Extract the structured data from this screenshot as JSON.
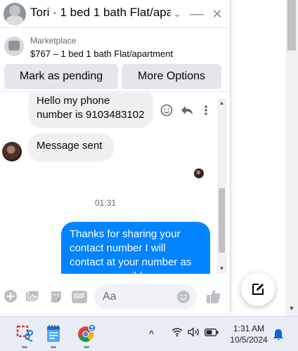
{
  "header": {
    "title": "Tori · 1 bed 1 bath Flat/apa...",
    "minimize_glyph": "—",
    "close_glyph": "✕",
    "dropdown_glyph": "⌄"
  },
  "marketplace": {
    "label": "Marketplace",
    "listing": "$767 – 1 bed 1 bath Flat/apartment",
    "buttons": [
      "Mark as pending",
      "More Options"
    ]
  },
  "messages": [
    {
      "direction": "incoming",
      "text": "Hello my phone number is 9103483102"
    },
    {
      "direction": "incoming",
      "text": "Message sent"
    },
    {
      "direction": "outgoing",
      "text": "Thanks for sharing your contact number I will contact at your number as soon as possible"
    }
  ],
  "timestamp": "01:31",
  "composer": {
    "placeholder": "Aa",
    "gif_label": "GIF"
  },
  "taskbar": {
    "time": "1:31 AM",
    "date": "10/5/2024",
    "tray_chevron": "^"
  },
  "colors": {
    "outgoing_bubble": "#0084ff",
    "incoming_bubble": "#f0f0f0",
    "taskbar": "#e9eef6"
  },
  "icons": [
    "chevron-down-icon",
    "minimize-icon",
    "close-icon",
    "emoji-icon",
    "reply-icon",
    "more-icon",
    "plus-icon",
    "photo-icon",
    "sticker-icon",
    "gif-icon",
    "like-icon",
    "compose-icon",
    "snip-icon",
    "notepad-icon",
    "chrome-icon",
    "wifi-icon",
    "volume-icon",
    "battery-icon",
    "notification-bell-icon"
  ]
}
